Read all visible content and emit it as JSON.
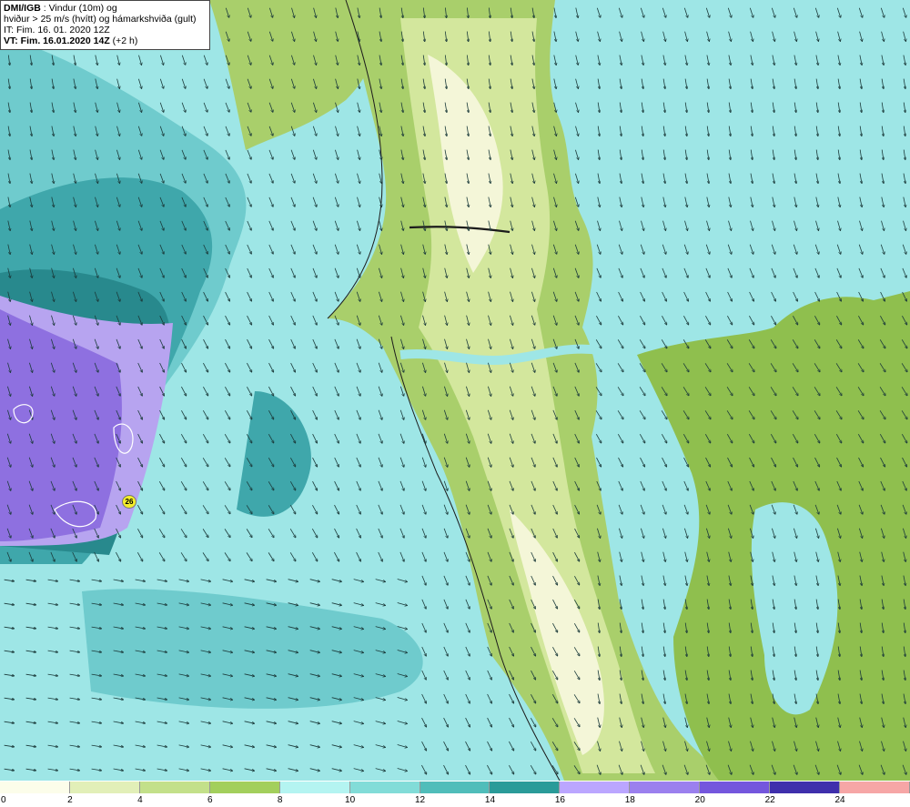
{
  "header": {
    "source": "DMI/IGB",
    "line1_rest": " : Vindur (10m) og",
    "line2": "hviður > 25 m/s (hvítt) og hámarkshviða (gult)",
    "line3": "IT: Fim. 16. 01. 2020 12Z",
    "line4_bold": "VT: Fim. 16.01.2020 14Z",
    "line4_rest": " (+2 h)"
  },
  "max_gust_label": "26",
  "colors": {
    "land_low": "#f4f6d8",
    "land_mid": "#d3e79d",
    "land_green": "#a9cf6b",
    "land_dark": "#8fbf4e",
    "sea_light": "#9ee6e6",
    "sea_mid": "#6fcbcd",
    "sea_dark": "#3fa7ab",
    "sea_deep": "#28898d",
    "wind_purple_light": "#b7a4f0",
    "wind_purple": "#8e70e0",
    "gust_marker": "#f3ee2a"
  },
  "legend": {
    "ticks": [
      "0",
      "2",
      "4",
      "6",
      "8",
      "10",
      "12",
      "14",
      "16",
      "18",
      "20",
      "22",
      "24"
    ],
    "colors": [
      "#fcfdea",
      "#e2efb8",
      "#c3e08a",
      "#a3cf5c",
      "#b4f4f1",
      "#82dcd8",
      "#50bdba",
      "#2a9b99",
      "#bba6ff",
      "#9b80ee",
      "#7456dd",
      "#3f2fac",
      "#f6a6a6"
    ]
  }
}
